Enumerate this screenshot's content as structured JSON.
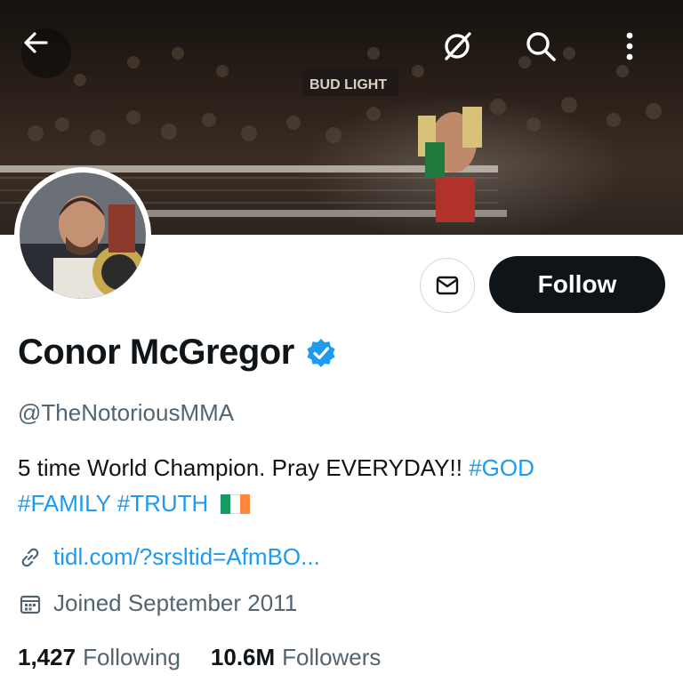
{
  "header": {
    "back_icon": "arrow-left-icon",
    "grok_icon": "slashed-circle-icon",
    "search_icon": "search-icon",
    "more_icon": "more-vertical-icon",
    "banner_sign": "BUD LIGHT"
  },
  "actions": {
    "message_icon": "envelope-icon",
    "follow_label": "Follow"
  },
  "profile": {
    "name": "Conor McGregor",
    "verified_icon": "verified-badge-icon",
    "handle": "@TheNotoriousMMA",
    "bio_text": "5 time World Champion. Pray EVERYDAY!!",
    "hashtags": [
      "#GOD",
      "#FAMILY",
      "#TRUTH"
    ],
    "flag_colors": [
      "#169b62",
      "#ffffff",
      "#ff883e"
    ],
    "link": "tidl.com/?srsltid=AfmBO...",
    "joined": "Joined September 2011"
  },
  "stats": {
    "following_count": "1,427",
    "following_label": "Following",
    "followers_count": "10.6M",
    "followers_label": "Followers"
  },
  "colors": {
    "accent": "#1d9bf0",
    "text": "#0f1419",
    "secondary": "#536471"
  }
}
